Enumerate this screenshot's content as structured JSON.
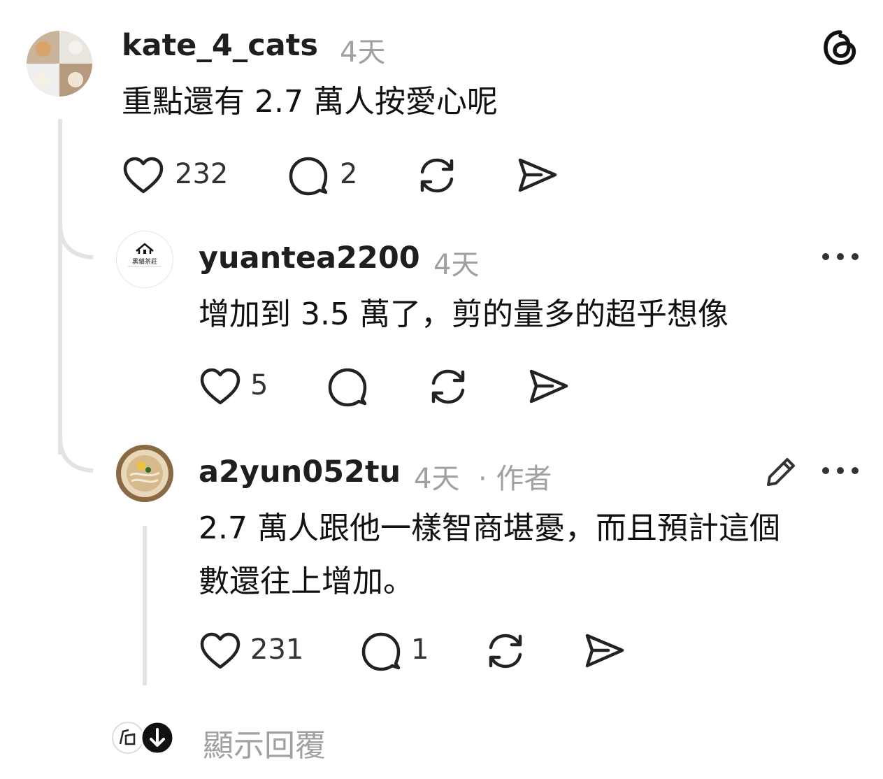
{
  "comments": [
    {
      "username": "kate_4_cats",
      "time": "4天",
      "text": "重點還有 2.7 萬人按愛心呢",
      "likes": "232",
      "replies": "2"
    },
    {
      "username": "yuantea2200",
      "time": "4天",
      "avatar_text": "黑貓茶莊",
      "text": "增加到 3.5 萬了，剪的量多的超乎想像",
      "likes": "5",
      "replies": ""
    },
    {
      "username": "a2yun052tu",
      "time": "4天",
      "author_tag": "· 作者",
      "text_line1": "2.7 萬人跟他一樣智商堪憂，而且預計這個",
      "text_line2": "數還往上增加。",
      "likes": "231",
      "replies": "1"
    }
  ],
  "show_replies_label": "顯示回覆",
  "icons": [
    "threads-logo-icon",
    "heart-icon",
    "comment-icon",
    "repost-icon",
    "share-icon",
    "more-icon",
    "edit-icon",
    "arrow-down-icon"
  ]
}
